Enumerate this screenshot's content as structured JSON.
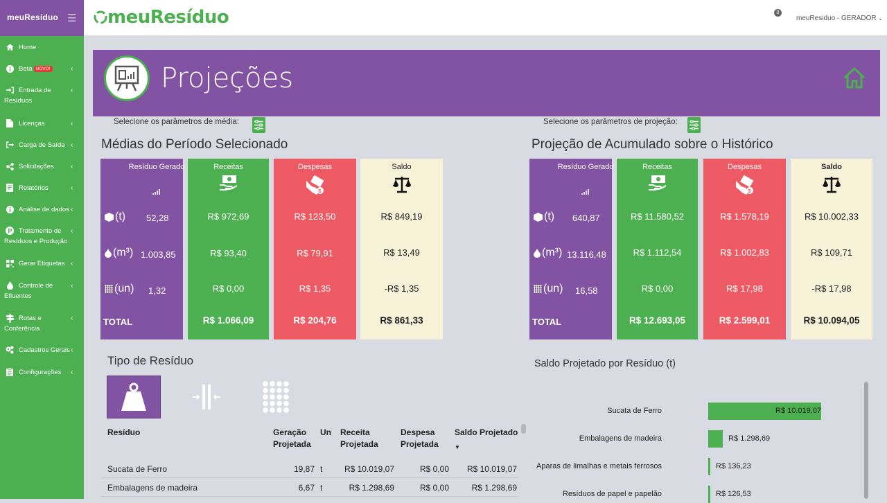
{
  "sidebar": {
    "brand": "meuResíduo",
    "items": [
      {
        "label": "Home",
        "icon": "home-icon"
      },
      {
        "label": "Beta",
        "badge": "NOVO!",
        "icon": "info-icon"
      },
      {
        "label": "Entrada de Resíduos",
        "icon": "sign-in-icon"
      },
      {
        "label": "Licenças",
        "icon": "document-icon"
      },
      {
        "label": "Carga de Saída",
        "icon": "sign-out-icon"
      },
      {
        "label": "Solicitações",
        "icon": "share-icon"
      },
      {
        "label": "Relatórios",
        "icon": "report-icon"
      },
      {
        "label": "Análise de dados",
        "icon": "info-icon"
      },
      {
        "label": "Tratamento de Resíduos e Produção",
        "icon": "process-icon"
      },
      {
        "label": "Gerar Etiquetas",
        "icon": "barcode-icon"
      },
      {
        "label": "Controle de Efluentes",
        "icon": "drop-icon"
      },
      {
        "label": "Rotas e Conferência",
        "icon": "signpost-icon"
      },
      {
        "label": "Cadastros Gerais",
        "icon": "gears-icon"
      },
      {
        "label": "Configurações",
        "icon": "clipboard-icon"
      }
    ]
  },
  "topbar": {
    "logo": "meuResíduo",
    "notif_count": "0",
    "user": "meuResiduo - GERADOR"
  },
  "banner": {
    "title": "Projeções"
  },
  "medias": {
    "param_label": "Selecione os parâmetros de média:",
    "title": "Médias do Período Selecionado",
    "residuo": {
      "header": "Resíduo Gerado",
      "rows": [
        {
          "unit": "(t)",
          "value": "52,28"
        },
        {
          "unit": "(m³)",
          "value": "1.003,85"
        },
        {
          "unit": "(un)",
          "value": "1,32"
        }
      ],
      "total_label": "TOTAL"
    },
    "receitas": {
      "header": "Receitas",
      "values": [
        "R$ 972,69",
        "R$ 93,40",
        "R$ 0,00"
      ],
      "total": "R$ 1.066,09"
    },
    "despesas": {
      "header": "Despesas",
      "values": [
        "R$ 123,50",
        "R$ 79,91",
        "R$ 1,35"
      ],
      "total": "R$ 204,76"
    },
    "saldo": {
      "header": "Saldo",
      "values": [
        "R$ 849,19",
        "R$ 13,49",
        "-R$ 1,35"
      ],
      "total": "R$ 861,33"
    }
  },
  "projecao": {
    "param_label": "Selecione os parâmetros de projeção:",
    "title": "Projeção de Acumulado sobre o Histórico",
    "residuo": {
      "header": "Resíduo Gerado",
      "rows": [
        {
          "unit": "(t)",
          "value": "640,87"
        },
        {
          "unit": "(m³)",
          "value": "13.116,48"
        },
        {
          "unit": "(un)",
          "value": "16,58"
        }
      ],
      "total_label": "TOTAL"
    },
    "receitas": {
      "header": "Receitas",
      "values": [
        "R$ 11.580,52",
        "R$ 1.112,54",
        "R$ 0,00"
      ],
      "total": "R$ 12.693,05"
    },
    "despesas": {
      "header": "Despesas",
      "values": [
        "R$ 1.578,19",
        "R$ 1.002,83",
        "R$ 17,98"
      ],
      "total": "R$ 2.599,01"
    },
    "saldo": {
      "header": "Saldo",
      "values": [
        "R$ 10.002,33",
        "R$ 109,71",
        "-R$ 17,98"
      ],
      "total": "R$ 10.094,05"
    }
  },
  "tipo": {
    "title": "Tipo de Resíduo",
    "buttons": [
      {
        "icon": "weight-icon",
        "selected": true
      },
      {
        "icon": "compress-icon"
      },
      {
        "icon": "grid-dots-icon"
      }
    ]
  },
  "table": {
    "headers": {
      "residuo": "Resíduo",
      "geracao": "Geração Projetada",
      "un": "Un",
      "receita": "Receita Projetada",
      "despesa": "Despesa Projetada",
      "saldo": "Saldo Projetado"
    },
    "rows": [
      {
        "residuo": "Sucata de Ferro",
        "geracao": "19,87",
        "un": "t",
        "receita": "R$ 10.019,07",
        "despesa": "R$ 0,00",
        "saldo": "R$ 10.019,07"
      },
      {
        "residuo": "Embalagens de madeira",
        "geracao": "6,67",
        "un": "t",
        "receita": "R$ 1.298,69",
        "despesa": "R$ 0,00",
        "saldo": "R$ 1.298,69"
      }
    ]
  },
  "saldo_chart": {
    "title": "Saldo Projetado por Resíduo (t)"
  },
  "chart_data": {
    "type": "bar",
    "orientation": "horizontal",
    "title": "Saldo Projetado por Resíduo (t)",
    "categories": [
      "Sucata de Ferro",
      "Embalagens de madeira",
      "Aparas de limalhas e metais ferrosos",
      "Resíduos de papel e papelão"
    ],
    "values": [
      10019.07,
      1298.69,
      136.23,
      126.53
    ],
    "labels": [
      "R$ 10.019,07",
      "R$ 1.298,69",
      "R$ 136,23",
      "R$ 126,53"
    ],
    "bar_color": "#4caf50"
  }
}
